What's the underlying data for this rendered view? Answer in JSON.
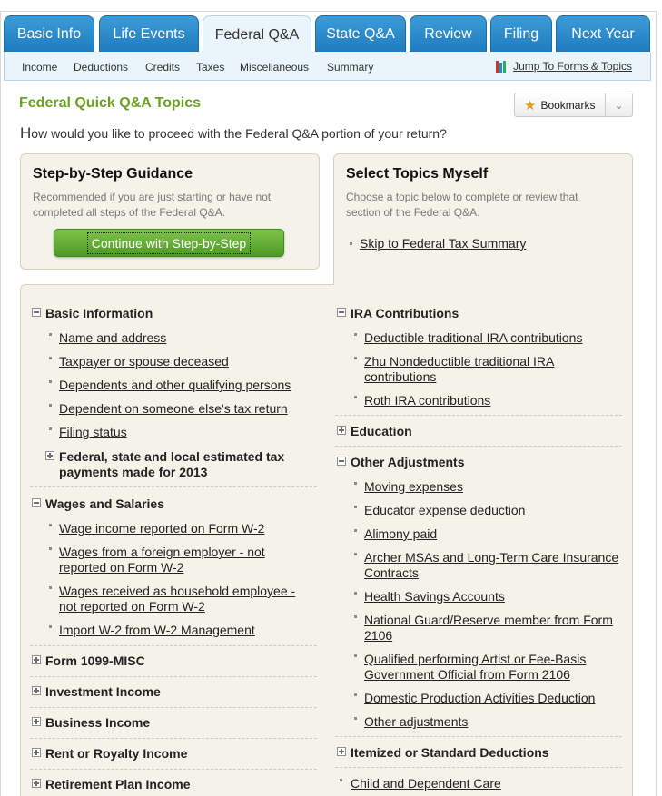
{
  "tabs": [
    "Basic Info",
    "Life Events",
    "Federal Q&A",
    "State Q&A",
    "Review",
    "Filing",
    "Next Year"
  ],
  "subnav": {
    "items": [
      "Income",
      "Deductions",
      "Credits",
      "Taxes",
      "Miscellaneous",
      "Summary"
    ],
    "jump": "Jump To Forms & Topics"
  },
  "page": {
    "title": "Federal Quick Q&A Topics",
    "bookmarks": "Bookmarks",
    "question_cap": "H",
    "question_rest": "ow would you like to proceed with the Federal Q&A portion of your return?"
  },
  "left_panel": {
    "heading": "Step-by-Step Guidance",
    "desc1": "Recommended if you are just starting or have not",
    "desc2": "completed all steps of the Federal Q&A.",
    "button": "Continue with Step-by-Step"
  },
  "right_panel": {
    "heading": "Select Topics Myself",
    "desc1": "Choose a topic below to complete or review that",
    "desc2": "section of the Federal Q&A.",
    "skip": "Skip to Federal Tax Summary"
  },
  "left_col": {
    "basic": "Basic Information",
    "basic_items": [
      "Name and address",
      "Taxpayer or spouse deceased",
      "Dependents and other qualifying persons",
      "Dependent on someone else's tax return",
      "Filing status"
    ],
    "estimated_1": "Federal, state and local estimated tax",
    "estimated_2": "payments made for 2013",
    "wages": "Wages and Salaries",
    "wage_a": "Wage income reported on Form W-2",
    "wage_b1": "Wages from a foreign employer - not",
    "wage_b2": "reported on Form W-2",
    "wage_c1": "Wages received as household employee -",
    "wage_c2": "not reported on Form W-2",
    "wage_d": "Import W-2 from W-2 Management",
    "collapsed": [
      "Form 1099-MISC",
      "Investment Income",
      "Business Income",
      "Rent or Royalty Income",
      "Retirement Plan Income"
    ]
  },
  "right_col": {
    "ira": "IRA Contributions",
    "ira_a": "Deductible traditional IRA contributions",
    "ira_b1": "Zhu Nondeductible traditional IRA",
    "ira_b2": "contributions",
    "ira_c": "Roth IRA contributions",
    "education": "Education",
    "other": "Other Adjustments",
    "adj_a": "Moving expenses",
    "adj_b": "Educator expense deduction",
    "adj_c": "Alimony paid",
    "adj_d1": "Archer MSAs and Long-Term Care Insurance",
    "adj_d2": "Contracts",
    "adj_e": "Health Savings Accounts",
    "adj_f1": "National Guard/Reserve member from Form",
    "adj_f2": "2106",
    "adj_g1": "Qualified performing Artist or Fee-Basis",
    "adj_g2": "Government Official from Form 2106",
    "adj_h": "Domestic Production Activities Deduction",
    "adj_i": "Other adjustments",
    "itemized": "Itemized or Standard Deductions",
    "child_care": "Child and Dependent Care"
  }
}
